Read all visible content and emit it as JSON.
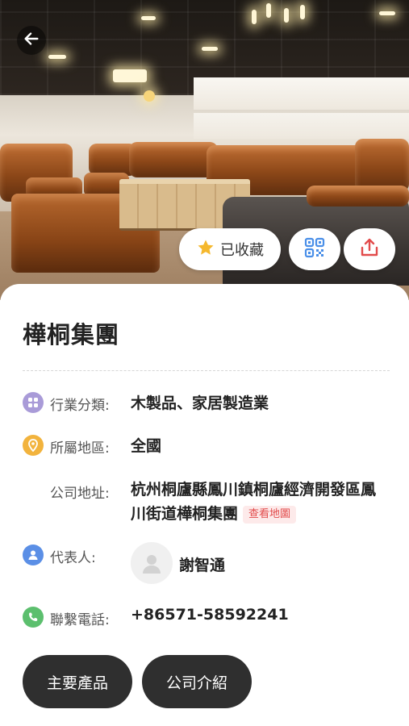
{
  "company": {
    "name": "樺桐集團"
  },
  "actions": {
    "favorite_label": "已收藏"
  },
  "info": {
    "industry": {
      "label": "行業分類:",
      "value": "木製品、家居製造業"
    },
    "region": {
      "label": "所屬地區:",
      "value": "全國"
    },
    "address": {
      "label": "公司地址:",
      "value": "杭州桐廬縣鳳川鎮桐廬經濟開發區鳳川街道樺桐集團",
      "map_link": "查看地圖"
    },
    "representative": {
      "label": "代表人:",
      "value": "謝智通"
    },
    "phone": {
      "label": "聯繫電話:",
      "value": "+86571-58592241"
    }
  },
  "tabs": [
    {
      "label": "主要產品"
    },
    {
      "label": "公司介紹"
    }
  ],
  "colors": {
    "industry_icon": "#a99bd8",
    "region_icon": "#f2b33d",
    "representative_icon": "#5b8fe6",
    "phone_icon": "#5cbf6e",
    "favorite_star": "#f5b82e",
    "qr_icon": "#4a8fe8",
    "share_icon": "#e24b4b",
    "map_tag": "#e24b4b",
    "pill": "#2f2f2f"
  },
  "icons": {
    "back": "arrow-left-icon",
    "favorite": "star-icon",
    "qr": "qr-code-icon",
    "share": "share-icon",
    "industry": "grid-icon",
    "region": "location-pin-icon",
    "representative": "person-icon",
    "phone": "phone-icon"
  }
}
